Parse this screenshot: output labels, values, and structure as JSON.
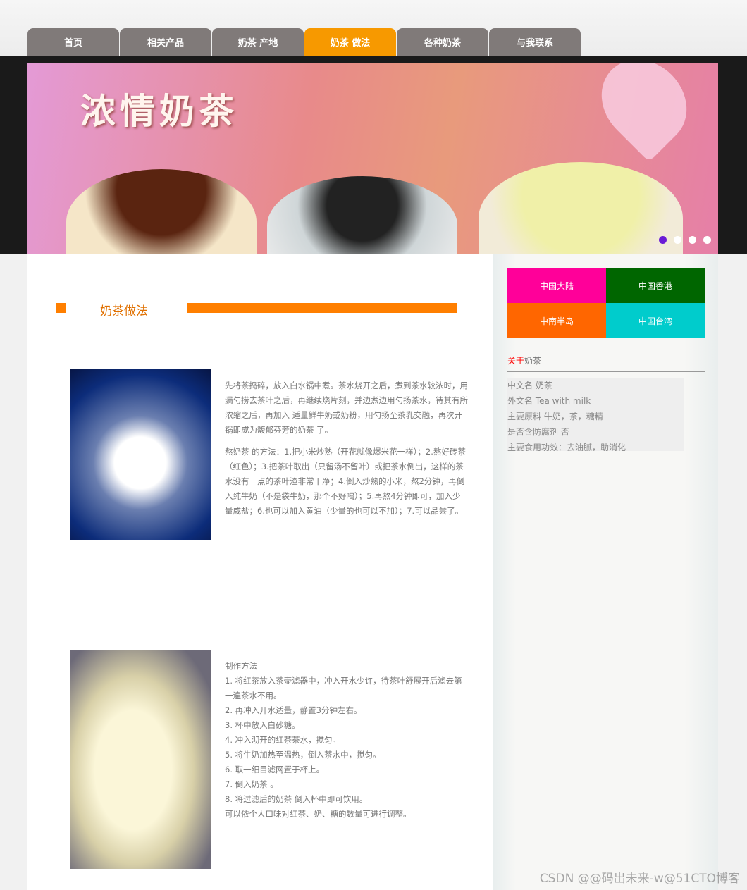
{
  "nav": {
    "items": [
      "首页",
      "相关产品",
      "奶茶 产地",
      "奶茶 做法",
      "各种奶茶",
      "与我联系"
    ],
    "active_index": 3,
    "active_color": "#f79900"
  },
  "banner": {
    "title": "浓情奶茶",
    "slide_count": 4,
    "active_slide": 1
  },
  "section": {
    "title": "奶茶做法",
    "accent": "#ff7f00"
  },
  "article": {
    "p1": "先将茶捣碎，放入白水锅中煮。茶水烧开之后，煮到茶水较浓时，用漏勺捞去茶叶之后，再继续烧片刻，并边煮边用勺扬茶水，待其有所浓缩之后，再加入 适量鲜牛奶或奶粉，用勺扬至茶乳交融，再次开锅即成为馥郁芬芳的奶茶 了。",
    "p2": "熬奶茶 的方法：1.把小米炒熟（开花就像爆米花一样）；2.熬好砖茶（红色）；3.把茶叶取出（只留汤不留叶）或把茶水倒出，这样的茶水没有一点的茶叶渣非常干净；4.倒入炒熟的小米，熬2分钟，再倒入纯牛奶（不是袋牛奶，那个不好喝）；5.再熬4分钟即可，加入少量咸盐；6.也可以加入黄油（少量的也可以不加）；7.可以品尝了。",
    "steps": [
      "制作方法",
      "1. 将红茶放入茶壶滤器中，冲入开水少许，待茶叶舒展开后滤去第一遍茶水不用。",
      "2. 再冲入开水适量，静置3分钟左右。",
      "3. 杯中放入白砂糖。",
      "4. 冲入沏开的红茶茶水，搅匀。",
      "5. 将牛奶加热至温热，倒入茶水中，搅匀。",
      "6. 取一细目滤网置于杯上。",
      "7. 倒入奶茶 。",
      "8. 将过滤后的奶茶 倒入杯中即可饮用。",
      "可以依个人口味对红茶、奶、糖的数量可进行调整。"
    ]
  },
  "sidebar": {
    "regions": [
      {
        "label": "中国大陆",
        "color": "#ff0099"
      },
      {
        "label": "中国香港",
        "color": "#006600"
      },
      {
        "label": "中南半岛",
        "color": "#ff6600"
      },
      {
        "label": "中国台湾",
        "color": "#00cccc"
      }
    ],
    "about_red": "关于",
    "about_rest": "奶茶",
    "info": [
      "中文名 奶茶",
      "外文名 Tea with milk",
      "主要原料 牛奶，茶，糖精",
      "是否含防腐剂 否",
      "主要食用功效：去油腻，助消化"
    ]
  },
  "watermark": "CSDN @@码出未来-w@51CTO博客"
}
